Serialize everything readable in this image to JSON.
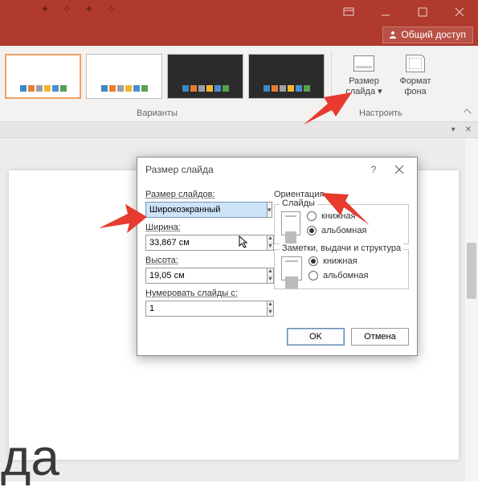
{
  "titlebar": {
    "decor": ""
  },
  "share": {
    "label": "Общий доступ"
  },
  "ribbon": {
    "size_label": "Размер слайда",
    "size_dropdown_marker": "▾",
    "format_label": "Формат фона",
    "group_variants": "Варианты",
    "group_custom": "Настроить"
  },
  "dialog": {
    "title": "Размер слайда",
    "size_for": "Размер слайдов:",
    "size_value": "Широкоэкранный",
    "width_label": "Ширина:",
    "width_value": "33,867 см",
    "height_label": "Высота:",
    "height_value": "19,05 см",
    "number_from_label": "Нумеровать слайды с:",
    "number_from_value": "1",
    "orientation_label": "Ориентация",
    "slides_group": "Слайды",
    "notes_group": "Заметки, выдачи и структура",
    "opt_portrait": "книжная",
    "opt_landscape": "альбомная",
    "ok": "OK",
    "cancel": "Отмена"
  },
  "slide": {
    "title_text": "да"
  }
}
